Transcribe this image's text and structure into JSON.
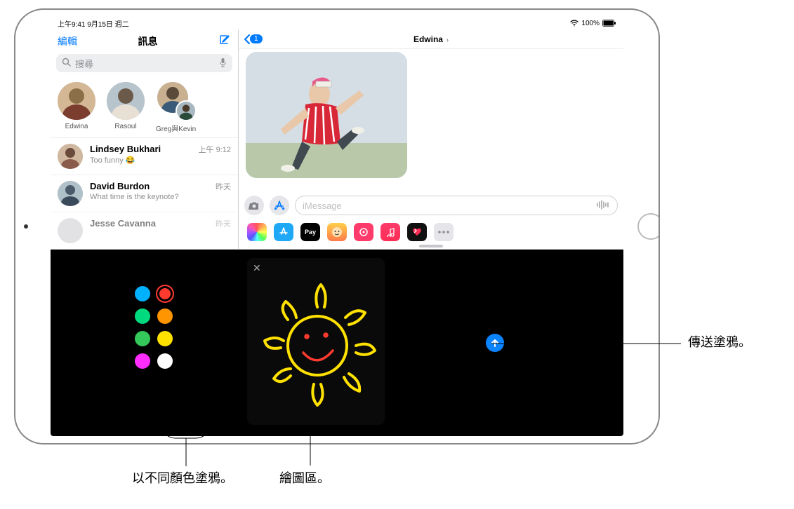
{
  "status": {
    "time_date": "上午9:41  9月15日 週二",
    "battery_pct": "100%"
  },
  "sidebar": {
    "edit": "編輯",
    "title": "訊息",
    "search_placeholder": "搜尋",
    "pinned": [
      {
        "name": "Edwina"
      },
      {
        "name": "Rasoul"
      },
      {
        "name": "Greg與Kevin"
      }
    ],
    "conversations": [
      {
        "name": "Lindsey Bukhari",
        "preview": "Too funny 😂",
        "time": "上午 9:12"
      },
      {
        "name": "David Burdon",
        "preview": "What time is the keynote?",
        "time": "昨天"
      },
      {
        "name": "Jesse Cavanna",
        "preview": "",
        "time": "昨天"
      }
    ]
  },
  "conversation": {
    "back_count": "1",
    "title": "Edwina",
    "input_placeholder": "iMessage"
  },
  "apps": {
    "pay_label": "Pay"
  },
  "digital_touch": {
    "colors": [
      {
        "hex": "#00b1ff",
        "selected": false
      },
      {
        "hex": "#ff3b30",
        "selected": true
      },
      {
        "hex": "#00d97e",
        "selected": false
      },
      {
        "hex": "#ff9500",
        "selected": false
      },
      {
        "hex": "#34c759",
        "selected": false
      },
      {
        "hex": "#ffe100",
        "selected": false
      },
      {
        "hex": "#ff2dff",
        "selected": false
      },
      {
        "hex": "#ffffff",
        "selected": false
      }
    ]
  },
  "callouts": {
    "send": "傳送塗鴉。",
    "colors": "以不同顏色塗鴉。",
    "canvas": "繪圖區。"
  }
}
